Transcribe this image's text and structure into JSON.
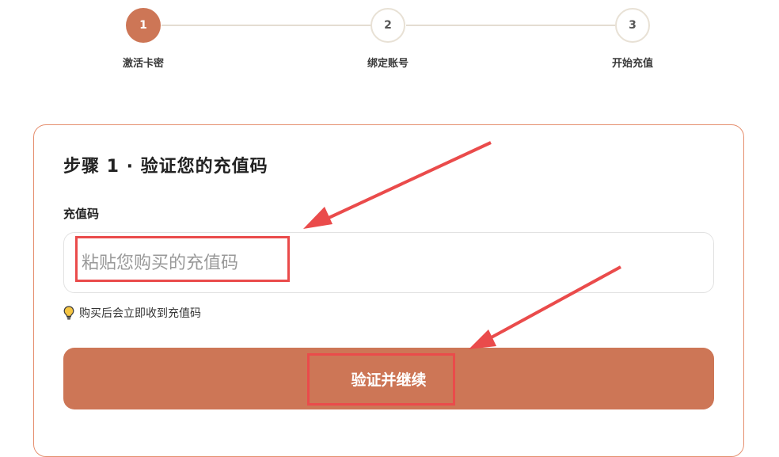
{
  "stepper": {
    "steps": [
      {
        "number": "1",
        "label": "激活卡密",
        "state": "active"
      },
      {
        "number": "2",
        "label": "绑定账号",
        "state": "inactive"
      },
      {
        "number": "3",
        "label": "开始充值",
        "state": "inactive"
      }
    ]
  },
  "card": {
    "title": "步骤 1 · 验证您的充值码",
    "field_label": "充值码",
    "input": {
      "value": "",
      "placeholder": "粘贴您购买的充值码"
    },
    "hint": {
      "icon": "lightbulb-icon",
      "text": "购买后会立即收到充值码"
    },
    "submit_label": "验证并继续"
  },
  "colors": {
    "accent": "#cd7656",
    "card_border": "#e58f6f",
    "annotation": "#ea4b4b"
  }
}
